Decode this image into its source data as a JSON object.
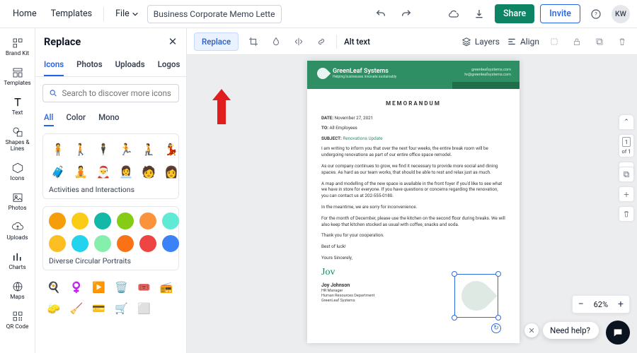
{
  "top": {
    "home": "Home",
    "templates": "Templates",
    "file": "File",
    "design_name": "Business Corporate Memo Letter",
    "share": "Share",
    "invite": "Invite",
    "user_initials": "KW"
  },
  "rail": [
    {
      "label": "Brand Kit",
      "icon": "brandkit"
    },
    {
      "label": "Templates",
      "icon": "templates"
    },
    {
      "label": "Text",
      "icon": "text"
    },
    {
      "label": "Shapes &\nLines",
      "icon": "shapes"
    },
    {
      "label": "Icons",
      "icon": "icons"
    },
    {
      "label": "Photos",
      "icon": "photos"
    },
    {
      "label": "Uploads",
      "icon": "uploads"
    },
    {
      "label": "Charts",
      "icon": "charts"
    },
    {
      "label": "Maps",
      "icon": "maps"
    },
    {
      "label": "QR Code",
      "icon": "qr"
    }
  ],
  "panel": {
    "title": "Replace",
    "tabs": [
      "Icons",
      "Photos",
      "Uploads",
      "Logos"
    ],
    "active_tab": "Icons",
    "search_placeholder": "Search to discover more icons",
    "subtabs": [
      "All",
      "Color",
      "Mono"
    ],
    "active_subtab": "All",
    "group1_label": "Activities and Interactions",
    "group2_label": "Diverse Circular Portraits",
    "portrait_colors": [
      "#f59e0b",
      "#facc15",
      "#14b8a6",
      "#84cc16",
      "#fb923c",
      "#5eead4",
      "#fbbf24",
      "#22d3ee",
      "#86efac",
      "#f97316",
      "#ef4444",
      "#3b82f6"
    ],
    "footer_emoji": [
      "🍳",
      "♀️",
      "▶️",
      "🗑️",
      "🎟️",
      "📻",
      "🧽",
      "🧹",
      "💳",
      "🛒",
      "⬜"
    ]
  },
  "canvas_toolbar": {
    "replace": "Replace",
    "alt_text": "Alt text",
    "layers": "Layers",
    "align": "Align"
  },
  "doc": {
    "brand": "GreenLeaf Systems",
    "brand_sub": "Helping businesses innovate sustainably",
    "email": "greenleafsystems.com",
    "email2": "hr@greenleafsystems.com",
    "memo_title": "MEMORANDUM",
    "date_label": "DATE:",
    "date_value": "November 27, 2021",
    "to_label": "TO:",
    "to_value": "All Employees",
    "subject_label": "SUBJECT:",
    "subject_value": "Renovations Update",
    "p1": "I am writing to inform you that over the next four weeks, the entire break room will be undergoing renovations as part of our entire office space remodel.",
    "p2": "As our company continues to grow, we find it necessary to provide more social and dining spaces. As hard as our team works, that should be able to rest and relax just as much.",
    "p3": "A map and modelling of the new space is available in the front foyer if you'd like to see what we have in store for everyone. If you have questions or concerns regarding the renovation, you can contact us at 202-555-0180.",
    "p4": "In the meantime, we are sorry for inconvenience.",
    "p5": "For the month of December, please use the kitchen on the second floor during breaks. We will also keep that kitchen stocked as usual with coffee, snacks and soda.",
    "thanks": "Thank you for your cooperation.",
    "best": "Best of luck!",
    "sincerely": "Yours Sincerely,",
    "sig": "Jov",
    "sig_name": "Joy Johnson",
    "sig_role1": "HR Manager",
    "sig_role2": "Human Resources Department",
    "sig_role3": "GreenLeaf Systems"
  },
  "zoom": {
    "value": "62%"
  },
  "help": {
    "text": "Need help?"
  },
  "pager": {
    "page": "1",
    "total": "of 1"
  }
}
